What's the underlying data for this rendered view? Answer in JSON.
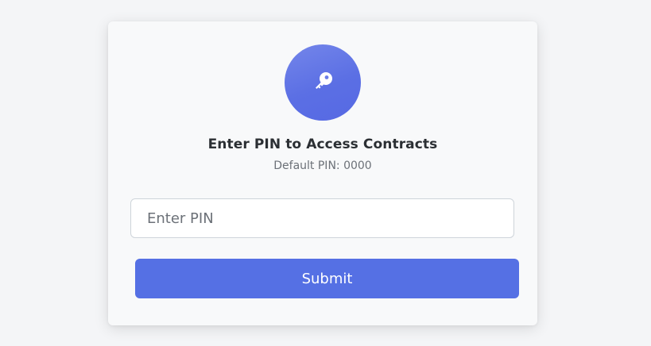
{
  "pin_dialog": {
    "icon": "key-icon",
    "title": "Enter PIN to Access Contracts",
    "subtitle": "Default PIN: 0000",
    "input": {
      "placeholder": "Enter PIN",
      "value": ""
    },
    "submit_label": "Submit"
  },
  "colors": {
    "accent": "#5570e4",
    "icon_gradient_start": "#7486ea",
    "icon_gradient_end": "#5669e3",
    "page_background": "#f4f5f7",
    "card_background": "#f8f9fa"
  }
}
